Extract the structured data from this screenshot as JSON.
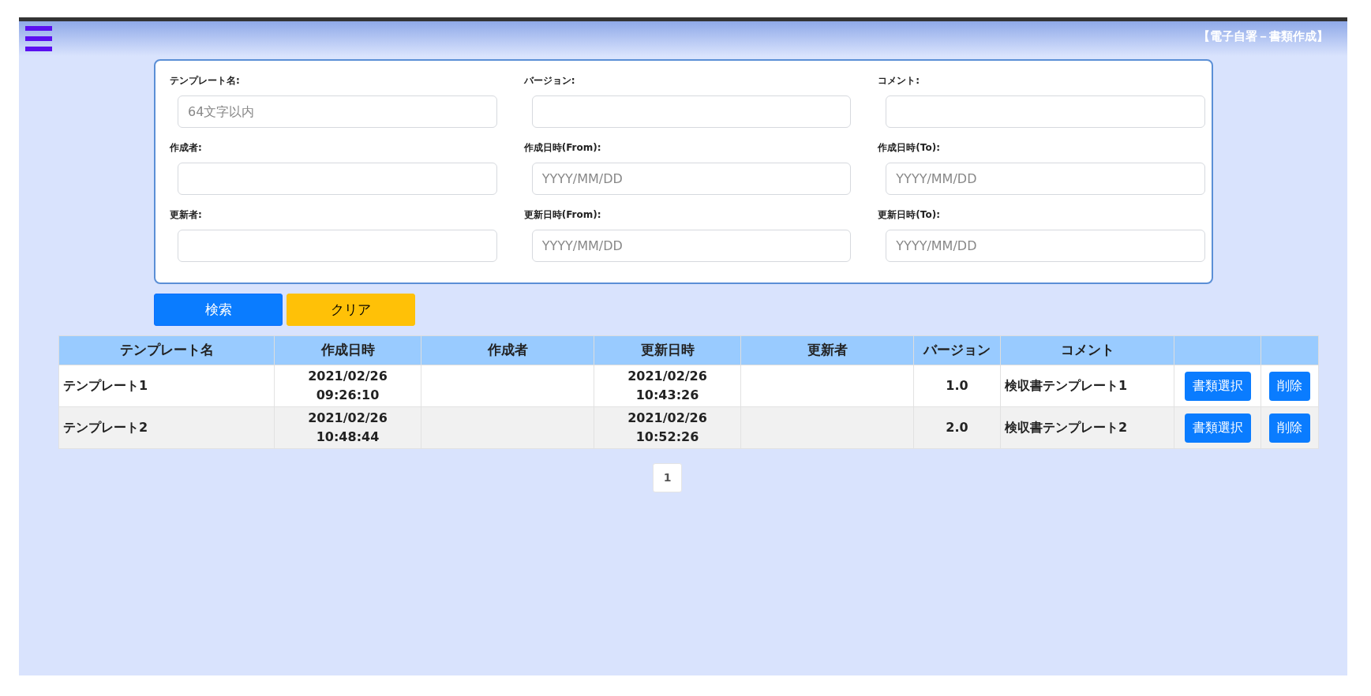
{
  "header": {
    "title": "【電子自署－書類作成】"
  },
  "search_form": {
    "fields": [
      {
        "label": "テンプレート名:",
        "placeholder": "64文字以内"
      },
      {
        "label": "バージョン:"
      },
      {
        "label": "コメント:"
      },
      {
        "label": "作成者:"
      },
      {
        "label": "作成日時(From):",
        "placeholder": "YYYY/MM/DD"
      },
      {
        "label": "作成日時(To):",
        "placeholder": "YYYY/MM/DD"
      },
      {
        "label": "更新者:"
      },
      {
        "label": "更新日時(From):",
        "placeholder": "YYYY/MM/DD"
      },
      {
        "label": "更新日時(To):",
        "placeholder": "YYYY/MM/DD"
      }
    ],
    "buttons": [
      {
        "label": "検索",
        "kind": "primary"
      },
      {
        "label": "クリア",
        "kind": "warning"
      }
    ]
  },
  "table": {
    "columns": [
      "テンプレート名",
      "作成日時",
      "作成者",
      "更新日時",
      "更新者",
      "バージョン",
      "コメント"
    ],
    "rows": [
      {
        "cells": [
          "テンプレート1",
          "2021/02/26 09:26:10",
          "",
          "2021/02/26 10:43:26",
          "",
          "1.0",
          "検収書テンプレート1"
        ],
        "actions": [
          "書類選択",
          "削除"
        ]
      },
      {
        "cells": [
          "テンプレート2",
          "2021/02/26 10:48:44",
          "",
          "2021/02/26 10:52:26",
          "",
          "2.0",
          "検収書テンプレート2"
        ],
        "actions": [
          "書類選択",
          "削除"
        ]
      }
    ]
  },
  "pagination": {
    "pages": [
      {
        "label": "1",
        "selected": true
      }
    ]
  }
}
